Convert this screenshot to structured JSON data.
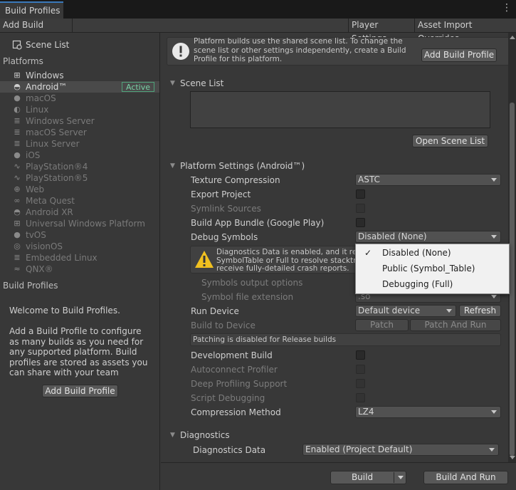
{
  "window": {
    "tab_title": "Build Profiles",
    "menu_icon": "kebab-menu-icon"
  },
  "toolbar": {
    "add_build_profile": "Add Build Profile",
    "player_settings": "Player Settings",
    "asset_import_overrides": "Asset Import Overrides"
  },
  "sidebar": {
    "scene_list_label": "Scene List",
    "platforms_header": "Platforms",
    "platforms": [
      {
        "label": "Windows",
        "icon": "windows-icon",
        "enabled": true
      },
      {
        "label": "Android™",
        "icon": "android-icon",
        "enabled": true,
        "selected": true,
        "badge": "Active"
      },
      {
        "label": "macOS",
        "icon": "apple-icon",
        "enabled": false
      },
      {
        "label": "Linux",
        "icon": "linux-icon",
        "enabled": false
      },
      {
        "label": "Windows Server",
        "icon": "server-icon",
        "enabled": false
      },
      {
        "label": "macOS Server",
        "icon": "server-icon",
        "enabled": false
      },
      {
        "label": "Linux Server",
        "icon": "server-icon",
        "enabled": false
      },
      {
        "label": "iOS",
        "icon": "apple-icon",
        "enabled": false
      },
      {
        "label": "PlayStation®4",
        "icon": "playstation-icon",
        "enabled": false
      },
      {
        "label": "PlayStation®5",
        "icon": "playstation-icon",
        "enabled": false
      },
      {
        "label": "Web",
        "icon": "globe-icon",
        "enabled": false
      },
      {
        "label": "Meta Quest",
        "icon": "meta-icon",
        "enabled": false
      },
      {
        "label": "Android XR",
        "icon": "android-icon",
        "enabled": false
      },
      {
        "label": "Universal Windows Platform",
        "icon": "windows-icon",
        "enabled": false
      },
      {
        "label": "tvOS",
        "icon": "apple-icon",
        "enabled": false
      },
      {
        "label": "visionOS",
        "icon": "visionos-icon",
        "enabled": false
      },
      {
        "label": "Embedded Linux",
        "icon": "server-icon",
        "enabled": false
      },
      {
        "label": "QNX®",
        "icon": "qnx-icon",
        "enabled": false
      }
    ],
    "build_profiles_header": "Build Profiles",
    "welcome_title": "Welcome to Build Profiles.",
    "welcome_body": "Add a Build Profile to configure as many builds as you need for any supported platform. Build profiles are stored as assets you can share with your team",
    "add_build_profile_button": "Add Build Profile"
  },
  "info_box": {
    "text": "Platform builds use the shared scene list. To change the scene list or other settings independently, create a Build Profile for this platform.",
    "button": "Add Build Profile"
  },
  "scene_list": {
    "header": "Scene List",
    "open_button": "Open Scene List"
  },
  "platform_settings": {
    "header": "Platform Settings (Android™)",
    "texture_compression": {
      "label": "Texture Compression",
      "value": "ASTC"
    },
    "export_project": {
      "label": "Export Project"
    },
    "symlink_sources": {
      "label": "Symlink Sources"
    },
    "build_app_bundle": {
      "label": "Build App Bundle (Google Play)"
    },
    "debug_symbols": {
      "label": "Debug Symbols",
      "value": "Disabled (None)"
    },
    "warning": "Diagnostics Data is enabled, and it require SymbolTable or Full to resolve stacktrace to receive fully-detailed crash reports.",
    "symbols_output_options": "Symbols output options",
    "symbol_file_extension": {
      "label": "Symbol file extension",
      "value": ".so"
    },
    "run_device": {
      "label": "Run Device",
      "value": "Default device",
      "refresh": "Refresh"
    },
    "build_to_device": {
      "label": "Build to Device",
      "patch": "Patch",
      "patch_and_run": "Patch And Run"
    },
    "patching_note": "Patching is disabled for Release builds",
    "development_build": {
      "label": "Development Build"
    },
    "autoconnect_profiler": {
      "label": "Autoconnect Profiler"
    },
    "deep_profiling_support": {
      "label": "Deep Profiling Support"
    },
    "script_debugging": {
      "label": "Script Debugging"
    },
    "compression_method": {
      "label": "Compression Method",
      "value": "LZ4"
    }
  },
  "diagnostics": {
    "header": "Diagnostics",
    "diagnostics_data": {
      "label": "Diagnostics Data",
      "value": "Enabled (Project Default)"
    }
  },
  "debug_symbols_popup": {
    "options": [
      {
        "label": "Disabled (None)",
        "checked": true
      },
      {
        "label": "Public (Symbol_Table)",
        "checked": false
      },
      {
        "label": "Debugging (Full)",
        "checked": false
      }
    ]
  },
  "footer": {
    "build": "Build",
    "build_and_run": "Build And Run"
  },
  "colors": {
    "accent_tab": "#3a79bb",
    "active_badge": "#79d2a6",
    "warning": "#f0c020"
  }
}
